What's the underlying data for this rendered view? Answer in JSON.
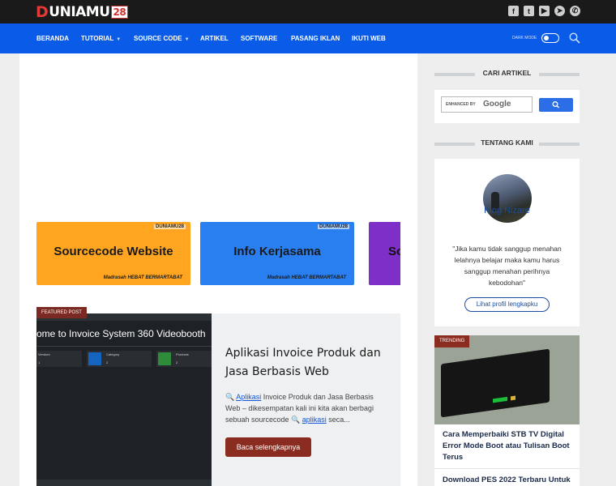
{
  "brand": {
    "logo_letter": "D",
    "logo_text": "UNIAMU",
    "logo_num": "28"
  },
  "social_icons": [
    {
      "name": "facebook-icon",
      "glyph": "f"
    },
    {
      "name": "twitter-icon",
      "glyph": "t"
    },
    {
      "name": "youtube-icon",
      "glyph": "▶"
    },
    {
      "name": "telegram-icon",
      "glyph": "➤"
    },
    {
      "name": "whatsapp-icon",
      "glyph": "✆"
    }
  ],
  "nav": {
    "items": [
      {
        "label": "BERANDA",
        "has_caret": false
      },
      {
        "label": "TUTORIAL",
        "has_caret": true
      },
      {
        "label": "SOURCE CODE",
        "has_caret": true
      },
      {
        "label": "ARTIKEL",
        "has_caret": false
      },
      {
        "label": "SOFTWARE",
        "has_caret": false
      },
      {
        "label": "PASANG IKLAN",
        "has_caret": false
      },
      {
        "label": "IKUTI WEB",
        "has_caret": false
      }
    ],
    "dark_mode_label": "DARK MODE",
    "caret_glyph": "▼"
  },
  "banners": [
    {
      "label": "Sourcecode Website",
      "brand": "DUNIAMU28",
      "footer": "Madrasah HEBAT BERMARTABAT",
      "color": "#ffa51f"
    },
    {
      "label": "Info Kerjasama",
      "brand": "DUNIAMU28",
      "footer": "Madrasah HEBAT BERMARTABAT",
      "color": "#2a7ff0"
    },
    {
      "label": "So",
      "color": "#7e2fc8"
    }
  ],
  "featured": {
    "badge": "FEATURED POST",
    "image_headline": "ome to Invoice System 360 Videobooth",
    "image_cards": [
      {
        "title": "Vendors",
        "value": "1"
      },
      {
        "title": "Category",
        "value": "2"
      },
      {
        "title": "Products",
        "value": "2"
      }
    ],
    "title": "Aplikasi Invoice Produk dan Jasa Berbasis Web",
    "excerpt_parts": [
      {
        "text": "🔍 ",
        "kw": false
      },
      {
        "text": "Aplikasi",
        "kw": true
      },
      {
        "text": " Invoice Produk dan Jasa Berbasis Web – dikesempatan kali ini kita akan berbagi sebuah sourcecode ",
        "kw": false
      },
      {
        "text": "🔍 ",
        "kw": false
      },
      {
        "text": "aplikasi",
        "kw": true
      },
      {
        "text": " seca...",
        "kw": false
      }
    ],
    "button_label": "Baca selengkapnya"
  },
  "sidebar": {
    "search": {
      "heading": "CARI ARTIKEL",
      "enhanced_label": "ENHANCED BY",
      "google_label": "Google"
    },
    "about": {
      "heading": "TENTANG KAMI",
      "name": "King Nizare",
      "quote": "\"Jika kamu tidak sanggup menahan lelahnya belajar maka kamu harus sanggup menahan perihnya kebodohan\"",
      "button_label": "Lihat profil lengkapku"
    },
    "trending": {
      "badge": "TRENDING",
      "post_title": "Cara Memperbaiki STB TV Digital Error Mode Boot atau Tulisan Boot Terus",
      "next_title": "Download PES 2022 Terbaru Untuk"
    }
  }
}
